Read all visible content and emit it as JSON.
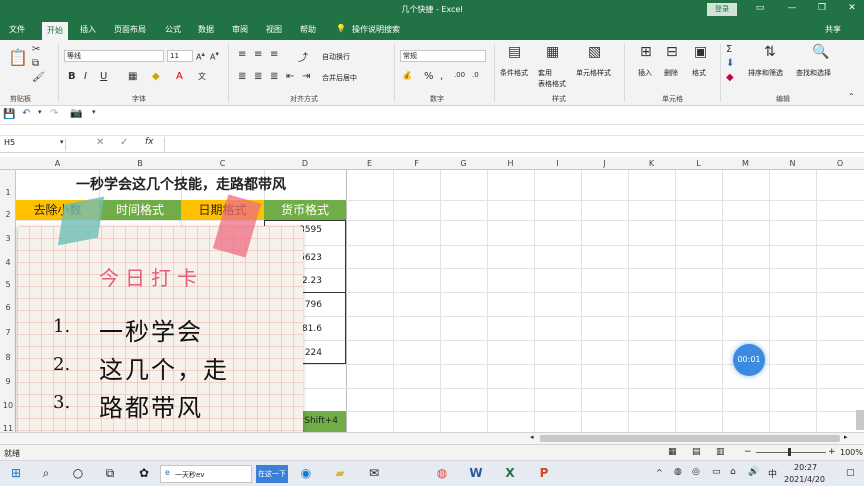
{
  "window": {
    "title": "几个快捷 - Excel",
    "login": "登录",
    "min": "—",
    "restore": "❐",
    "close": "✕"
  },
  "tabs": [
    "文件",
    "开始",
    "插入",
    "页面布局",
    "公式",
    "数据",
    "审阅",
    "视图",
    "帮助",
    "操作说明搜索",
    "共享"
  ],
  "ribbon": {
    "font_name": "等线",
    "font_size": "11",
    "number_format": "常规",
    "labels": {
      "wrap": "自动换行",
      "merge": "合并后居中",
      "cond_format": "条件格式",
      "table_format": "套用\n表格格式",
      "cell_style": "单元格样式",
      "insert": "插入",
      "delete": "删除",
      "format": "格式",
      "sort": "排序和筛选",
      "find": "查找和选择"
    },
    "groups": [
      "剪贴板",
      "字体",
      "对齐方式",
      "数字",
      "样式",
      "单元格",
      "编辑"
    ]
  },
  "formula_bar": {
    "name_box": "H5",
    "fx": "fx",
    "value": ""
  },
  "columns": [
    "A",
    "B",
    "C",
    "D",
    "E",
    "F",
    "G",
    "H",
    "I",
    "J",
    "K",
    "L",
    "M",
    "N",
    "O"
  ],
  "rows": [
    "1",
    "2",
    "3",
    "4",
    "5",
    "6",
    "7",
    "8",
    "9",
    "10",
    "11"
  ],
  "sheet": {
    "title": "一秒学会这几个技能，走路都带风",
    "headers": [
      "去除小数",
      "时间格式",
      "日期格式",
      "货币格式"
    ],
    "d_values": [
      "3595",
      "5623",
      "2.23",
      "796",
      "81.6",
      "224",
      ""
    ],
    "d11": "Shift+4"
  },
  "note": {
    "heading": "今日打卡",
    "lines": [
      {
        "num": "1.",
        "text": "一秒学会"
      },
      {
        "num": "2.",
        "text": "这几个，走"
      },
      {
        "num": "3.",
        "text": "路都带风"
      }
    ]
  },
  "timer": "00:01",
  "status": {
    "left": "就绪",
    "zoom": "100%"
  },
  "taskbar": {
    "search_text": "一天秒ev",
    "active_app": "在这一下",
    "time": "20:27",
    "date": "2021/4/20"
  },
  "colors": {
    "brand": "#217346",
    "header_orange": "#ffc000",
    "header_green": "#70ad47"
  }
}
